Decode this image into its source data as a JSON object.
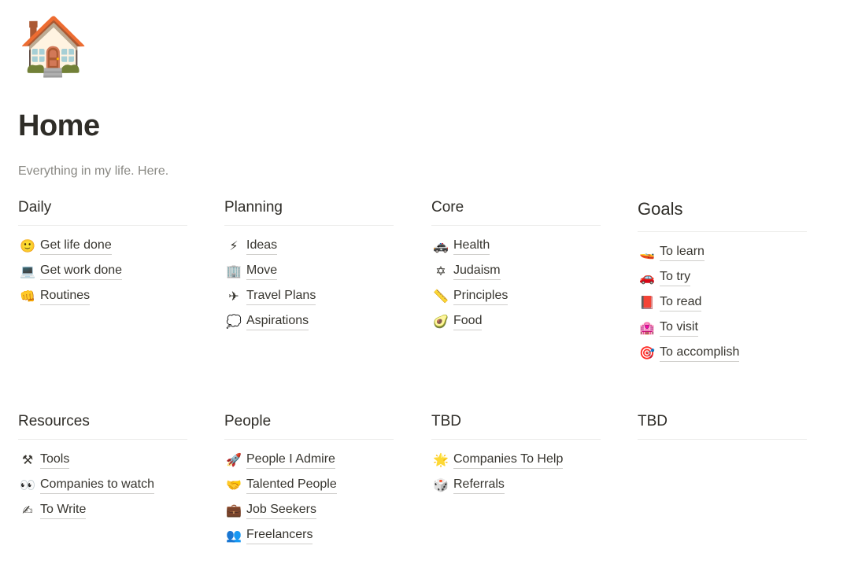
{
  "page": {
    "icon": "🏠",
    "icon_name": "house-icon",
    "title": "Home",
    "subtitle": "Everything in my life. Here."
  },
  "sections": {
    "daily": {
      "heading": "Daily",
      "items": [
        {
          "icon": "🙂",
          "icon_name": "smiley-icon",
          "label": "Get life done"
        },
        {
          "icon": "💻",
          "icon_name": "laptop-icon",
          "label": "Get work done"
        },
        {
          "icon": "👊",
          "icon_name": "fist-icon",
          "label": "Routines"
        }
      ]
    },
    "planning": {
      "heading": "Planning",
      "items": [
        {
          "icon": "⚡",
          "icon_name": "lightning-icon",
          "label": "Ideas"
        },
        {
          "icon": "🏢",
          "icon_name": "building-icon",
          "label": "Move"
        },
        {
          "icon": "✈",
          "icon_name": "airplane-icon",
          "label": "Travel Plans"
        },
        {
          "icon": "💭",
          "icon_name": "thought-bubble-icon",
          "label": "Aspirations"
        }
      ]
    },
    "core": {
      "heading": "Core",
      "items": [
        {
          "icon": "🚓",
          "icon_name": "ambulance-icon",
          "label": "Health"
        },
        {
          "icon": "✡",
          "icon_name": "star-of-david-icon",
          "label": "Judaism"
        },
        {
          "icon": "📏",
          "icon_name": "ruler-icon",
          "label": "Principles"
        },
        {
          "icon": "🥑",
          "icon_name": "avocado-icon",
          "label": "Food"
        }
      ]
    },
    "goals": {
      "heading": "Goals",
      "items": [
        {
          "icon": "🚤",
          "icon_name": "speedboat-icon",
          "label": "To learn"
        },
        {
          "icon": "🚗",
          "icon_name": "car-icon",
          "label": "To try"
        },
        {
          "icon": "📕",
          "icon_name": "red-book-icon",
          "label": "To read"
        },
        {
          "icon": "🏩",
          "icon_name": "building-heart-icon",
          "label": "To visit"
        },
        {
          "icon": "🎯",
          "icon_name": "target-icon",
          "label": "To accomplish"
        }
      ]
    },
    "resources": {
      "heading": "Resources",
      "items": [
        {
          "icon": "⚒",
          "icon_name": "hammer-pick-icon",
          "label": "Tools"
        },
        {
          "icon": "👀",
          "icon_name": "eyes-icon",
          "label": "Companies to watch"
        },
        {
          "icon": "✍",
          "icon_name": "writing-hand-icon",
          "label": "To Write"
        }
      ]
    },
    "people": {
      "heading": "People",
      "items": [
        {
          "icon": "🚀",
          "icon_name": "rocket-icon",
          "label": "People I Admire"
        },
        {
          "icon": "🤝",
          "icon_name": "handshake-icon",
          "label": "Talented People"
        },
        {
          "icon": "💼",
          "icon_name": "briefcase-icon",
          "label": "Job Seekers"
        },
        {
          "icon": "👥",
          "icon_name": "people-icon",
          "label": "Freelancers"
        }
      ]
    },
    "tbd1": {
      "heading": "TBD",
      "items": [
        {
          "icon": "🌟",
          "icon_name": "glowing-star-icon",
          "label": "Companies To Help"
        },
        {
          "icon": "🎲",
          "icon_name": "dice-icon",
          "label": "Referrals"
        }
      ]
    },
    "tbd2": {
      "heading": "TBD",
      "items": []
    }
  }
}
